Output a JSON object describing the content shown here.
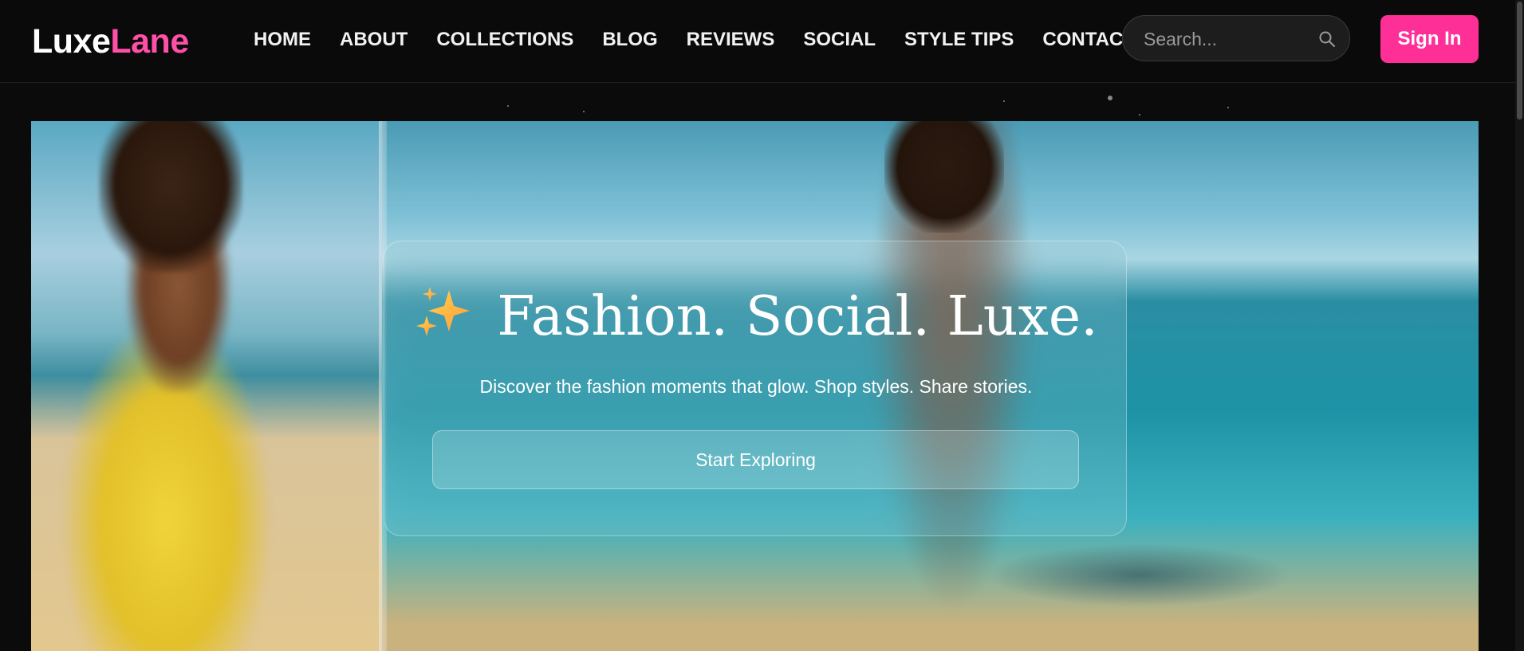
{
  "brand": {
    "part1": "Luxe",
    "part2": "Lane"
  },
  "nav": {
    "items": [
      {
        "label": "HOME"
      },
      {
        "label": "ABOUT"
      },
      {
        "label": "COLLECTIONS"
      },
      {
        "label": "BLOG"
      },
      {
        "label": "REVIEWS"
      },
      {
        "label": "SOCIAL"
      },
      {
        "label": "STYLE TIPS"
      },
      {
        "label": "CONTACT"
      }
    ]
  },
  "search": {
    "placeholder": "Search...",
    "value": ""
  },
  "signin_label": "Sign In",
  "hero": {
    "headline": "Fashion. Social. Luxe.",
    "icon": "sparkles-icon",
    "subline": "Discover the fashion moments that glow. Shop styles. Share stories.",
    "cta_label": "Start Exploring"
  },
  "colors": {
    "accent": "#ff2f98",
    "logo_accent": "#ff4fa8",
    "background": "#0b0b0b"
  }
}
